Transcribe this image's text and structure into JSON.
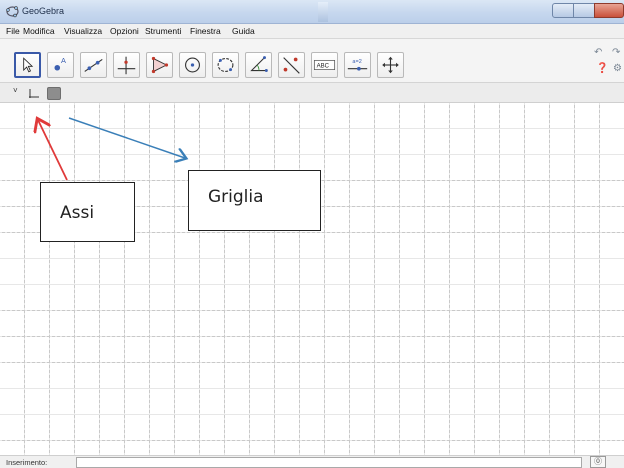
{
  "window": {
    "title": "GeoGebra"
  },
  "menu": {
    "items": [
      "File",
      "Modifica",
      "Visualizza",
      "Opzioni",
      "Strumenti",
      "Finestra",
      "Guida"
    ]
  },
  "toolbar": {
    "tools": [
      {
        "icon": "move-pointer-icon",
        "selected": true
      },
      {
        "icon": "new-point-icon"
      },
      {
        "icon": "line-through-two-points-icon"
      },
      {
        "icon": "perpendicular-line-icon"
      },
      {
        "icon": "polygon-icon"
      },
      {
        "icon": "circle-center-point-icon"
      },
      {
        "icon": "ellipse-icon"
      },
      {
        "icon": "angle-icon"
      },
      {
        "icon": "reflect-about-line-icon"
      },
      {
        "icon": "insert-text-icon",
        "text": "ABC"
      },
      {
        "icon": "slider-icon",
        "text": "a=2"
      },
      {
        "icon": "move-graphics-view-icon"
      }
    ]
  },
  "stylebar": {
    "toggle": "˅",
    "axes_icon": "axes-icon",
    "grid_icon": "grid-icon"
  },
  "annotations": {
    "assi": "Assi",
    "griglia": "Griglia",
    "assi_arrow_color": "#e03a3a",
    "griglia_arrow_color": "#3a7fb8"
  },
  "inputbar": {
    "label": "Inserimento:",
    "value": "",
    "help_icon": "⓪"
  }
}
